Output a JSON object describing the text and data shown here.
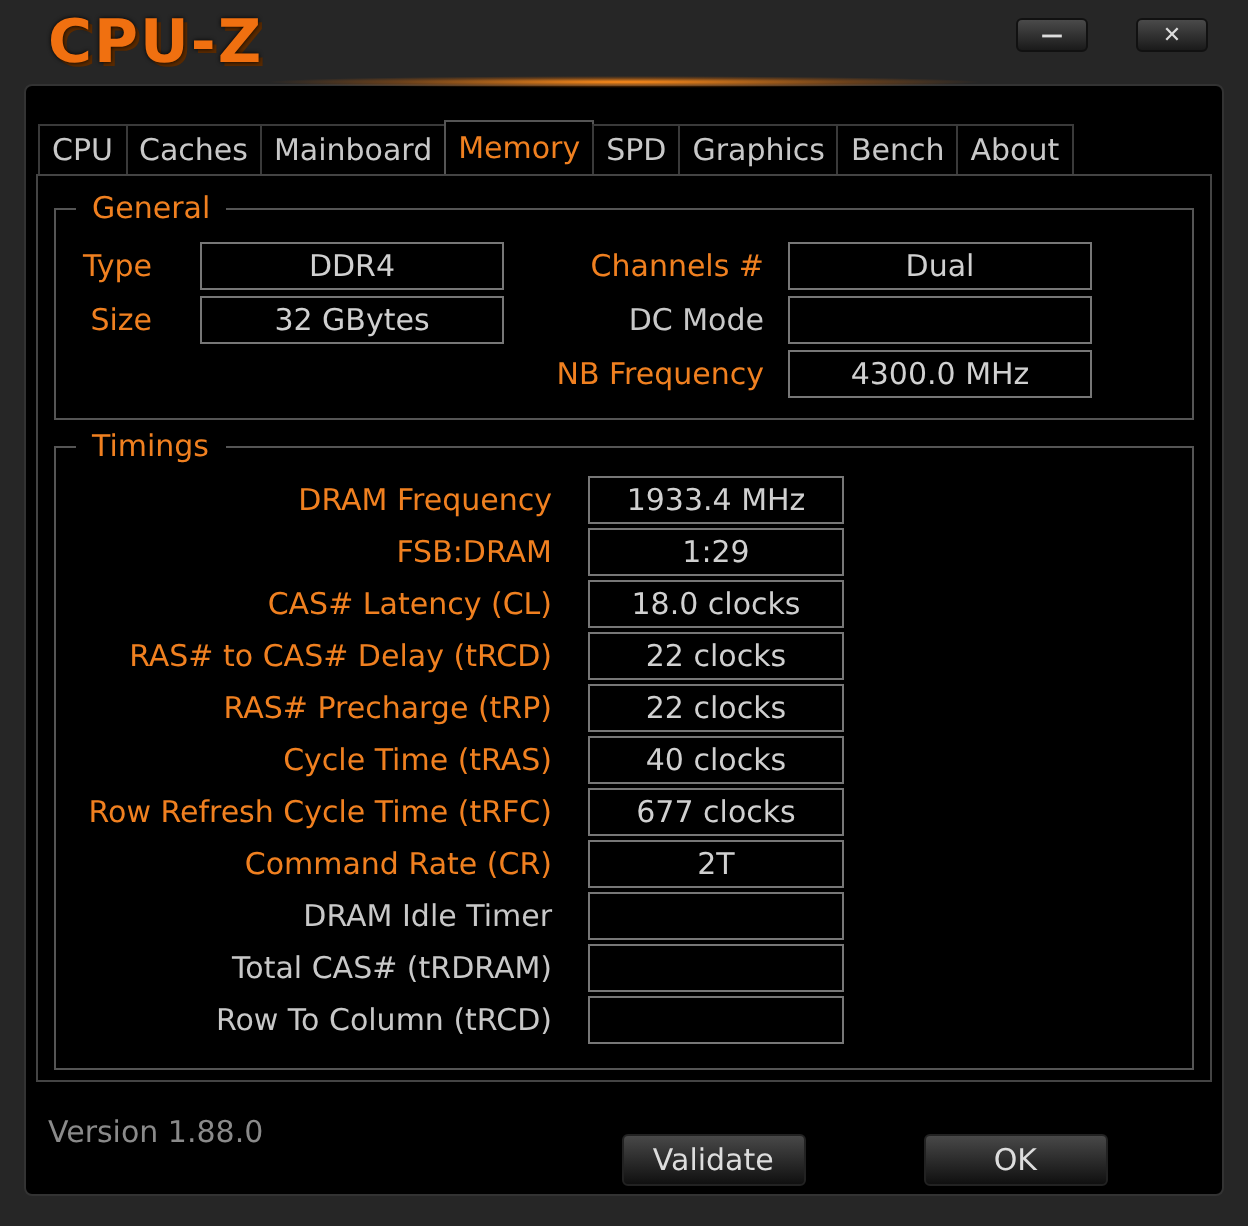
{
  "window": {
    "title": "CPU-Z",
    "controls": [
      "—",
      "✕"
    ]
  },
  "tabs": [
    {
      "label": "CPU",
      "selected": false
    },
    {
      "label": "Caches",
      "selected": false
    },
    {
      "label": "Mainboard",
      "selected": false
    },
    {
      "label": "Memory",
      "selected": true
    },
    {
      "label": "SPD",
      "selected": false
    },
    {
      "label": "Graphics",
      "selected": false
    },
    {
      "label": "Bench",
      "selected": false
    },
    {
      "label": "About",
      "selected": false
    }
  ],
  "general": {
    "title": "General",
    "left": [
      {
        "label": "Type",
        "value": "DDR4",
        "available": true
      },
      {
        "label": "Size",
        "value": "32 GBytes",
        "available": true
      }
    ],
    "right": [
      {
        "label": "Channels #",
        "value": "Dual",
        "available": true
      },
      {
        "label": "DC Mode",
        "available": false
      },
      {
        "label": "NB Frequency",
        "value": "4300.0 MHz",
        "available": true
      }
    ]
  },
  "timings": {
    "title": "Timings",
    "rows": [
      {
        "label": "DRAM Frequency",
        "value": "1933.4 MHz",
        "available": true
      },
      {
        "label": "FSB:DRAM",
        "value": "1:29",
        "available": true
      },
      {
        "label": "CAS# Latency (CL)",
        "value": "18.0 clocks",
        "available": true
      },
      {
        "label": "RAS# to CAS# Delay (tRCD)",
        "value": "22 clocks",
        "available": true
      },
      {
        "label": "RAS# Precharge (tRP)",
        "value": "22 clocks",
        "available": true
      },
      {
        "label": "Cycle Time (tRAS)",
        "value": "40 clocks",
        "available": true
      },
      {
        "label": "Row Refresh Cycle Time (tRFC)",
        "value": "677 clocks",
        "available": true
      },
      {
        "label": "Command Rate (CR)",
        "value": "2T",
        "available": true
      },
      {
        "label": "DRAM Idle Timer",
        "available": false
      },
      {
        "label": "Total CAS# (tRDRAM)",
        "available": false
      },
      {
        "label": "Row To Column (tRCD)",
        "available": false
      }
    ]
  },
  "footer": {
    "version": "Version 1.88.0",
    "buttons": [
      "Validate",
      "OK"
    ]
  }
}
